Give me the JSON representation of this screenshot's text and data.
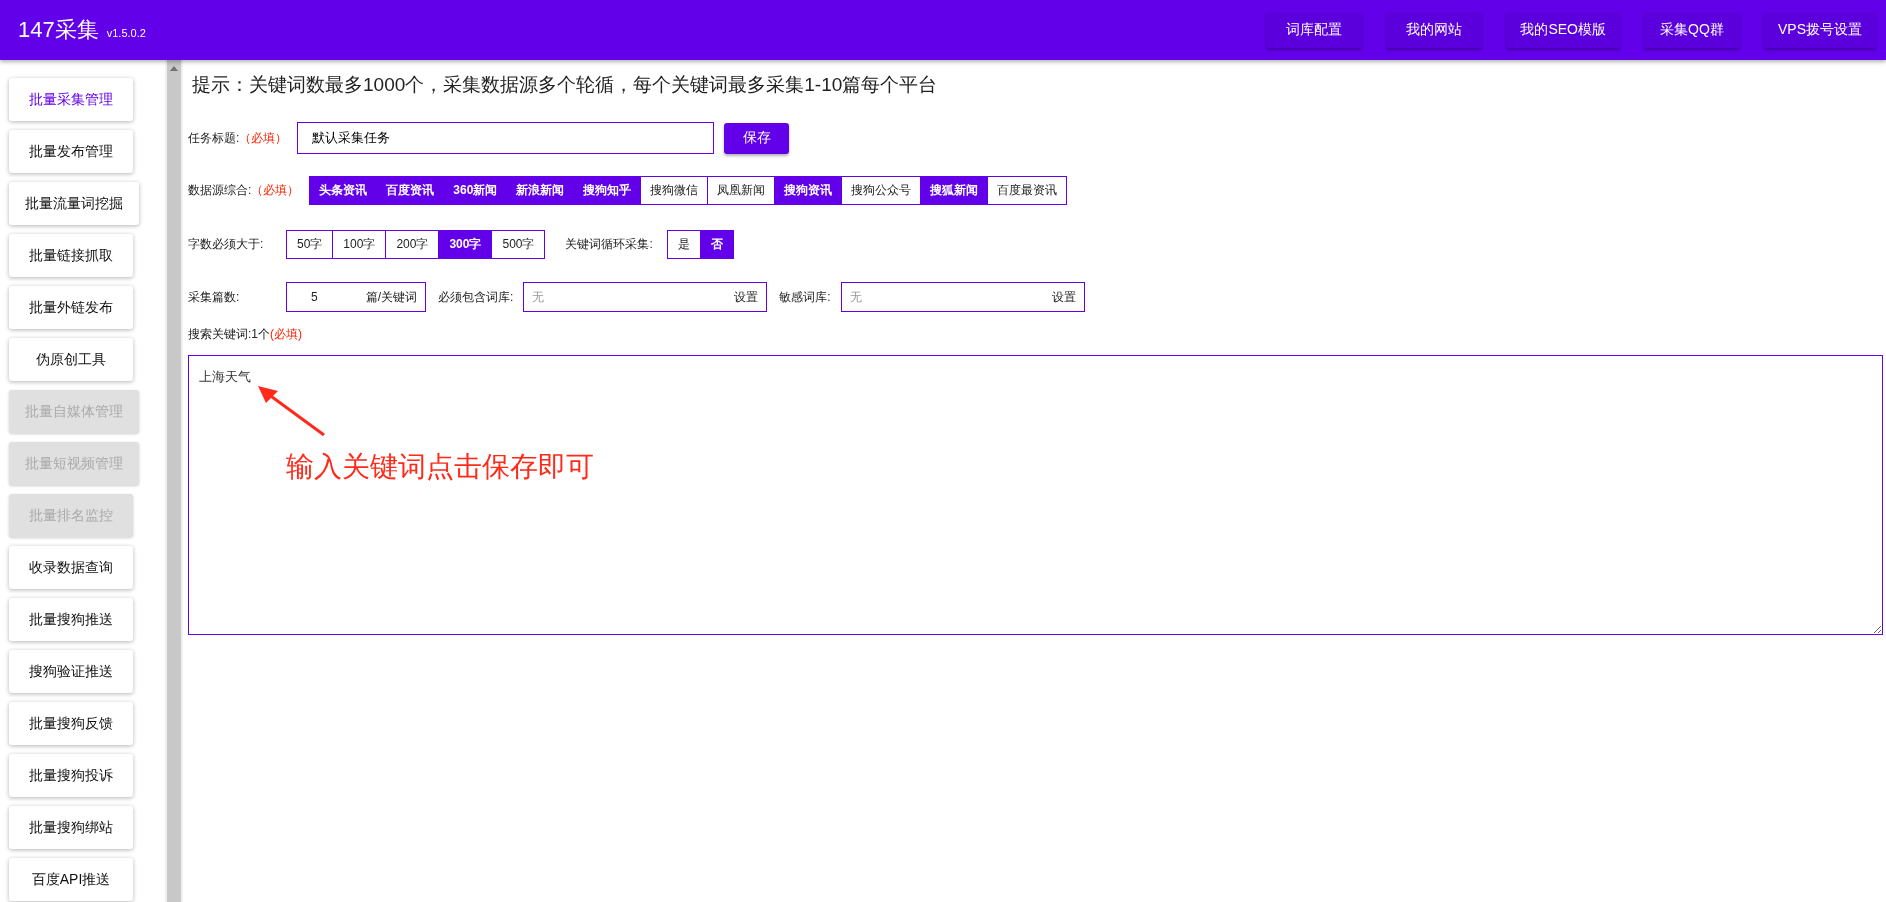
{
  "header": {
    "title": "147采集",
    "version": "v1.5.0.2",
    "nav": [
      "词库配置",
      "我的网站",
      "我的SEO模版",
      "采集QQ群",
      "VPS拨号设置"
    ]
  },
  "sidebar": {
    "items": [
      {
        "label": "批量采集管理",
        "selected": true,
        "disabled": false
      },
      {
        "label": "批量发布管理",
        "selected": false,
        "disabled": false
      },
      {
        "label": "批量流量词挖掘",
        "selected": false,
        "disabled": false
      },
      {
        "label": "批量链接抓取",
        "selected": false,
        "disabled": false
      },
      {
        "label": "批量外链发布",
        "selected": false,
        "disabled": false
      },
      {
        "label": "伪原创工具",
        "selected": false,
        "disabled": false
      },
      {
        "label": "批量自媒体管理",
        "selected": false,
        "disabled": true
      },
      {
        "label": "批量短视频管理",
        "selected": false,
        "disabled": true
      },
      {
        "label": "批量排名监控",
        "selected": false,
        "disabled": true
      },
      {
        "label": "收录数据查询",
        "selected": false,
        "disabled": false
      },
      {
        "label": "批量搜狗推送",
        "selected": false,
        "disabled": false
      },
      {
        "label": "搜狗验证推送",
        "selected": false,
        "disabled": false
      },
      {
        "label": "批量搜狗反馈",
        "selected": false,
        "disabled": false
      },
      {
        "label": "批量搜狗投诉",
        "selected": false,
        "disabled": false
      },
      {
        "label": "批量搜狗绑站",
        "selected": false,
        "disabled": false
      },
      {
        "label": "百度API推送",
        "selected": false,
        "disabled": false
      }
    ]
  },
  "hint": "提示：关键词数最多1000个，采集数据源多个轮循，每个关键词最多采集1-10篇每个平台",
  "task_title": {
    "label": "任务标题:",
    "required": "（必填）",
    "value": "默认采集任务",
    "save_button": "保存"
  },
  "sources": {
    "label": "数据源综合:",
    "required": "（必填）",
    "options": [
      {
        "label": "头条资讯",
        "selected": true
      },
      {
        "label": "百度资讯",
        "selected": true
      },
      {
        "label": "360新闻",
        "selected": true
      },
      {
        "label": "新浪新闻",
        "selected": true
      },
      {
        "label": "搜狗知乎",
        "selected": true
      },
      {
        "label": "搜狗微信",
        "selected": false
      },
      {
        "label": "凤凰新闻",
        "selected": false
      },
      {
        "label": "搜狗资讯",
        "selected": true
      },
      {
        "label": "搜狗公众号",
        "selected": false
      },
      {
        "label": "搜狐新闻",
        "selected": true
      },
      {
        "label": "百度最资讯",
        "selected": false
      }
    ]
  },
  "min_words": {
    "label": "字数必须大于:",
    "options": [
      {
        "label": "50字",
        "selected": false
      },
      {
        "label": "100字",
        "selected": false
      },
      {
        "label": "200字",
        "selected": false
      },
      {
        "label": "300字",
        "selected": true
      },
      {
        "label": "500字",
        "selected": false
      }
    ]
  },
  "loop": {
    "label": "关键词循环采集:",
    "options": [
      {
        "label": "是",
        "selected": false
      },
      {
        "label": "否",
        "selected": true
      }
    ]
  },
  "count": {
    "label": "采集篇数:",
    "value": "5",
    "unit": "篇/关键词"
  },
  "must_include": {
    "label": "必须包含词库:",
    "placeholder": "无",
    "button": "设置"
  },
  "sensitive": {
    "label": "敏感词库:",
    "placeholder": "无",
    "button": "设置"
  },
  "keywords": {
    "label": "搜索关键词:1个",
    "required": "(必填)",
    "value": "上海天气"
  },
  "annotation": {
    "text": "输入关键词点击保存即可"
  }
}
